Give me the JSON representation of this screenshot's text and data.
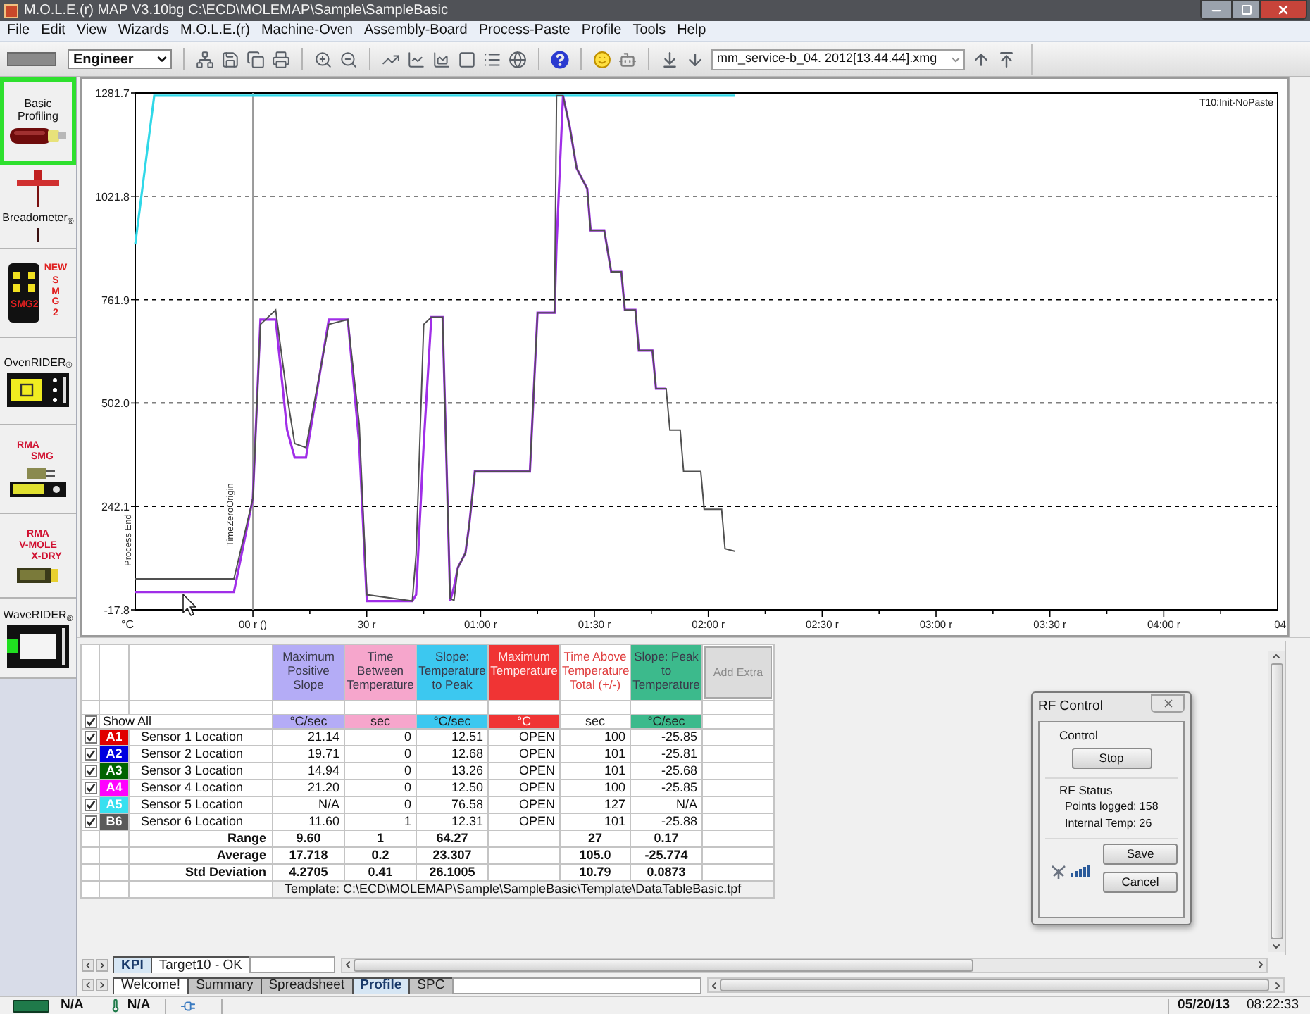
{
  "window": {
    "title": "M.O.L.E.(r) MAP V3.10bg C:\\ECD\\MOLEMAP\\Sample\\SampleBasic"
  },
  "menu": [
    "File",
    "Edit",
    "View",
    "Wizards",
    "M.O.L.E.(r)",
    "Machine-Oven",
    "Assembly-Board",
    "Process-Paste",
    "Profile",
    "Tools",
    "Help"
  ],
  "toolbar": {
    "user_level": "Engineer",
    "profile_file": "mm_service-b_04. 2012[13.44.44].xmg"
  },
  "sidebar": {
    "tools": [
      {
        "kind": "probe",
        "label": "Basic Profiling",
        "selected": true
      },
      {
        "kind": "breadometer",
        "label": "Breadometer$_{®}$",
        "selected": false
      },
      {
        "kind": "smg2",
        "badge": "NEW",
        "side_text": "SMG2",
        "device_text": "SMG2",
        "selected": false
      },
      {
        "kind": "ovenrider",
        "label": "OvenRIDER$_{®}$",
        "selected": false
      },
      {
        "kind": "rma_smg",
        "heading": [
          "RMA",
          "SMG"
        ],
        "selected": false
      },
      {
        "kind": "rma_vmole",
        "heading": [
          "RMA",
          "V-MOLE",
          "X-DRY"
        ],
        "selected": false
      },
      {
        "kind": "waverider",
        "label": "WaveRIDER$_{®}$",
        "selected": false
      }
    ]
  },
  "chart": {
    "caption": "T10:Init-NoPaste",
    "axis_caption": "Process End",
    "edge_tick_label": "04",
    "chart_data": {
      "type": "line",
      "ylabel": "°C",
      "grid": true,
      "x": [
        -31,
        -26,
        -5,
        0,
        2,
        6,
        9,
        11,
        14,
        20,
        25,
        28,
        30,
        42,
        43,
        45,
        47,
        50,
        52,
        53,
        54,
        56,
        57,
        58.5,
        73,
        75,
        79.5,
        80,
        81.7,
        83.5,
        85.3,
        88.1,
        89,
        92.6,
        94.4,
        97.1,
        98,
        100.8,
        101.7,
        105.3,
        106.2,
        108.9,
        109.9,
        112.6,
        113.5,
        118,
        118.9,
        123.5,
        124.4,
        127.1
      ],
      "series": [
        {
          "color": "#30d8e8",
          "values": [
            901,
            1275,
            1275,
            1275,
            1275,
            1275,
            1275,
            1275,
            1275,
            1275,
            1275,
            1275,
            1275,
            1275,
            1275,
            1275,
            1275,
            1275,
            1275,
            1275,
            1275,
            1275,
            1275,
            1275,
            1275,
            1275,
            1275,
            1275,
            1275,
            1275,
            1275,
            1275,
            1275,
            1275,
            1275,
            1275,
            1275,
            1275,
            1275,
            1275,
            1275,
            1275,
            1275,
            1275,
            1275,
            1275,
            1275,
            1275,
            1275,
            1275
          ]
        },
        {
          "color": "#a02ee8",
          "values": [
            27,
            27,
            27,
            262,
            712,
            712,
            434,
            365,
            365,
            712,
            712,
            400,
            4,
            4,
            20,
            400,
            718,
            718,
            4,
            40,
            88,
            125,
            195,
            330,
            330,
            729,
            729,
            900,
            1275,
            1196,
            1092,
            1041,
            936,
            936,
            832,
            832,
            736,
            736,
            634,
            634,
            538,
            538,
            null,
            null,
            null,
            null,
            null,
            null,
            null,
            null
          ]
        },
        {
          "color": "#505050",
          "values": [
            60,
            60,
            60,
            262,
            700,
            736,
            520,
            400,
            390,
            700,
            712,
            450,
            20,
            4,
            122,
            700,
            718,
            718,
            10,
            6,
            88,
            125,
            195,
            330,
            330,
            729,
            729,
            1275,
            1275,
            1196,
            1092,
            1041,
            936,
            936,
            832,
            832,
            736,
            736,
            634,
            634,
            538,
            538,
            434,
            434,
            330,
            330,
            235,
            235,
            136,
            129
          ]
        }
      ],
      "xlim": [
        -31,
        270
      ],
      "ylim": [
        -17.8,
        1281.7
      ],
      "xticks": [
        {
          "value": 0,
          "label": "00 r ()"
        },
        {
          "value": 30,
          "label": "30 r"
        },
        {
          "value": 60,
          "label": "01:00 r"
        },
        {
          "value": 90,
          "label": "01:30 r"
        },
        {
          "value": 120,
          "label": "02:00 r"
        },
        {
          "value": 150,
          "label": "02:30 r"
        },
        {
          "value": 180,
          "label": "03:00 r"
        },
        {
          "value": 210,
          "label": "03:30 r"
        },
        {
          "value": 240,
          "label": "04:00 r"
        }
      ],
      "yticks": [
        {
          "value": -17.8,
          "label": "-17.8"
        },
        {
          "value": 242.1,
          "label": "242.1"
        },
        {
          "value": 502,
          "label": "502.0"
        },
        {
          "value": 761.9,
          "label": "761.9"
        },
        {
          "value": 1021.8,
          "label": "1021.8"
        },
        {
          "value": 1281.7,
          "label": "1281.7"
        }
      ],
      "ref_lines": [
        {
          "axis": "x",
          "value": 0,
          "label": "TimeZeroOrigin",
          "color": "#9a9a9a"
        }
      ]
    }
  },
  "data_table": {
    "columns": [
      {
        "title": "Maximum Positive Slope",
        "unit": "°C/sec",
        "color": "#b4acf6",
        "summarized": true
      },
      {
        "title": "Time Between Temperature",
        "unit": "sec",
        "color": "#f6a6cc",
        "summarized": true
      },
      {
        "title": "Slope: Temperature to Peak",
        "unit": "°C/sec",
        "color": "#3cc8f0",
        "summarized": true
      },
      {
        "title": "Maximum Temperature",
        "unit": "°C",
        "color": "#f03434",
        "summarized": false
      },
      {
        "title": "Time Above Temperature Total (+/-)",
        "unit": "sec",
        "color": "#ffffff",
        "summarized": true
      },
      {
        "title": "Slope: Peak to Temperature",
        "unit": "°C/sec",
        "color": "#3cba8c",
        "summarized": true
      }
    ],
    "add_extra": "Add Extra",
    "show_all": {
      "label": "Show All",
      "checked": true
    },
    "rows": [
      {
        "channel": "A1",
        "color": "#e00000",
        "name": "Sensor 1 Location",
        "checked": true,
        "values": [
          "21.14",
          "0",
          "12.51",
          "OPEN",
          "100",
          "-25.85"
        ]
      },
      {
        "channel": "A2",
        "color": "#0000e0",
        "name": "Sensor 2 Location",
        "checked": true,
        "values": [
          "19.71",
          "0",
          "12.68",
          "OPEN",
          "101",
          "-25.81"
        ]
      },
      {
        "channel": "A3",
        "color": "#006400",
        "name": "Sensor 3 Location",
        "checked": true,
        "values": [
          "14.94",
          "0",
          "13.26",
          "OPEN",
          "101",
          "-25.68"
        ]
      },
      {
        "channel": "A4",
        "color": "#ff00ff",
        "name": "Sensor 4 Location",
        "checked": true,
        "values": [
          "21.20",
          "0",
          "12.50",
          "OPEN",
          "100",
          "-25.85"
        ]
      },
      {
        "channel": "A5",
        "color": "#38e0f0",
        "name": "Sensor 5 Location",
        "checked": true,
        "values": [
          "N/A",
          "0",
          "76.58",
          "OPEN",
          "127",
          "N/A"
        ]
      },
      {
        "channel": "B6",
        "color": "#5a5a5a",
        "name": "Sensor 6 Location",
        "checked": true,
        "values": [
          "11.60",
          "1",
          "12.31",
          "OPEN",
          "101",
          "-25.88"
        ]
      }
    ],
    "summary": [
      {
        "label": "Range",
        "values": [
          "9.60",
          "1",
          "64.27",
          "27",
          "0.17"
        ]
      },
      {
        "label": "Average",
        "values": [
          "17.718",
          "0.2",
          "23.307",
          "105.0",
          "-25.774"
        ]
      },
      {
        "label": "Std Deviation",
        "values": [
          "4.2705",
          "0.41",
          "26.1005",
          "10.79",
          "0.0873"
        ]
      }
    ],
    "template": "Template: C:\\ECD\\MOLEMAP\\Sample\\SampleBasic\\Template\\DataTableBasic.tpf"
  },
  "rf_control": {
    "title": "RF Control",
    "control_label": "Control",
    "stop_button": "Stop",
    "status_label": "RF Status",
    "status_lines": [
      "Points logged: 158",
      "Internal Temp: 26"
    ],
    "buttons": [
      "Save",
      "Cancel"
    ]
  },
  "sheet_tabs": [
    {
      "tabs": [
        {
          "label": "KPI",
          "selected": true,
          "color": "#d6e6f4"
        },
        {
          "label": "Target10 - OK",
          "selected": false,
          "color": "#ffffff"
        }
      ]
    },
    {
      "tabs": [
        {
          "label": "Welcome!",
          "selected": false,
          "color": "#ffffff"
        },
        {
          "label": "Summary",
          "selected": false,
          "color": "#c4c4c4"
        },
        {
          "label": "Spreadsheet",
          "selected": false,
          "color": "#c4c4c4"
        },
        {
          "label": "Profile",
          "selected": true,
          "color": "#d6e6f4"
        },
        {
          "label": "SPC",
          "selected": false,
          "color": "#c4c4c4"
        }
      ]
    }
  ],
  "status_bar": {
    "fields": [
      "N/A",
      "N/A"
    ],
    "date": "05/20/13",
    "time": "08:22:33"
  }
}
